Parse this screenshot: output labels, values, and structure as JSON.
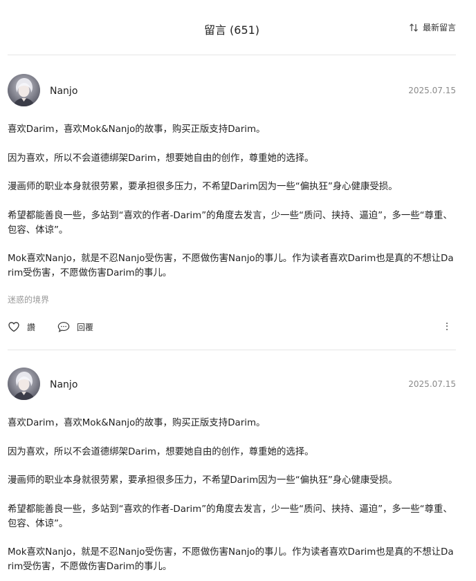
{
  "header": {
    "title": "留言 (651)",
    "sort_label": "最新留言",
    "sort_icon": "sort-arrows-icon"
  },
  "comments": [
    {
      "author": "Nanjo",
      "date": "2025.07.15",
      "paragraphs": [
        "喜欢Darim，喜欢Mok&Nanjo的故事，购买正版支持Darim。",
        "因为喜欢，所以不会道德绑架Darim，想要她自由的创作，尊重她的选择。",
        "漫画师的职业本身就很劳累，要承担很多压力，不希望Darim因为一些“偏执狂”身心健康受损。",
        "希望都能善良一些，多站到“喜欢的作者-Darim”的角度去发言，少一些“质问、挟持、逼迫”，多一些“尊重、包容、体谅”。",
        "Mok喜欢Nanjo，就是不忍Nanjo受伤害，不愿做伤害Nanjo的事儿。作为读者喜欢Darim也是真的不想让Darim受伤害，不愿做伤害Darim的事儿。"
      ],
      "tag": "迷惑的境界",
      "like_label": "讚",
      "reply_label": "回覆"
    },
    {
      "author": "Nanjo",
      "date": "2025.07.15",
      "paragraphs": [
        "喜欢Darim，喜欢Mok&Nanjo的故事，购买正版支持Darim。",
        "因为喜欢，所以不会道德绑架Darim，想要她自由的创作，尊重她的选择。",
        "漫画师的职业本身就很劳累，要承担很多压力，不希望Darim因为一些“偏执狂”身心健康受损。",
        "希望都能善良一些，多站到“喜欢的作者-Darim”的角度去发言，少一些“质问、挟持、逼迫”，多一些“尊重、包容、体谅”。",
        "Mok喜欢Nanjo，就是不忍Nanjo受伤害，不愿做伤害Nanjo的事儿。作为读者喜欢Darim也是真的不想让Darim受伤害，不愿做伤害Darim的事儿。"
      ]
    }
  ],
  "colors": {
    "text": "#222222",
    "muted": "#999999",
    "date": "#8a8a8a",
    "divider": "#e6e6e6"
  }
}
